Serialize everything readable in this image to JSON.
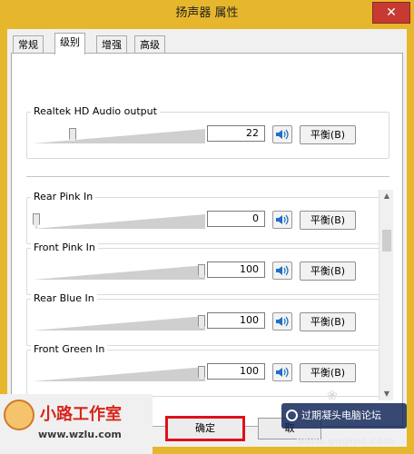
{
  "window": {
    "title": "扬声器 属性",
    "close_label": "✕"
  },
  "tabs": [
    {
      "label": "常规",
      "active": false
    },
    {
      "label": "级别",
      "active": true
    },
    {
      "label": "增强",
      "active": false
    },
    {
      "label": "高级",
      "active": false
    }
  ],
  "master": {
    "name": "Realtek HD Audio output",
    "value": "22",
    "level": 0.22,
    "balance_label": "平衡(B)"
  },
  "channels": [
    {
      "name": "Rear Pink In",
      "value": "0",
      "level": 0.0,
      "balance_label": "平衡(B)"
    },
    {
      "name": "Front Pink In",
      "value": "100",
      "level": 1.0,
      "balance_label": "平衡(B)"
    },
    {
      "name": "Rear Blue In",
      "value": "100",
      "level": 1.0,
      "balance_label": "平衡(B)"
    },
    {
      "name": "Front Green In",
      "value": "100",
      "level": 1.0,
      "balance_label": "平衡(B)"
    }
  ],
  "buttons": {
    "ok_label": "确定",
    "cancel_label": "取"
  },
  "watermark": {
    "logo_text": "小路工作室",
    "logo_url": "www.wzlu.com",
    "forum_text": "过期凝头电脑论坛",
    "forum_url": "www.gqgtpc.com"
  },
  "colors": {
    "ok_highlight": "#e0101a",
    "close_button": "#c63a32",
    "speaker_icon": "#1f6fc5"
  }
}
